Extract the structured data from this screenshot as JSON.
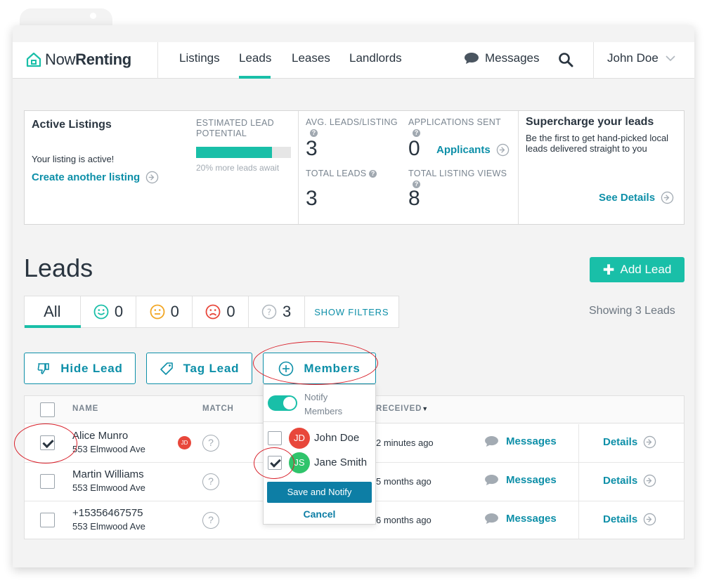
{
  "brand": {
    "name_a": "Now",
    "name_b": "Renting"
  },
  "nav": {
    "items": [
      "Listings",
      "Leads",
      "Leases",
      "Landlords"
    ],
    "messages": "Messages",
    "user": "John Doe"
  },
  "stats": {
    "active_title": "Active Listings",
    "active_text": "Your listing is active!",
    "create_link": "Create another listing",
    "estimated_label": "ESTIMATED LEAD POTENTIAL",
    "estimated_fraction": 0.8,
    "estimated_note": "20% more leads await",
    "avg_label": "AVG. LEADS/LISTING",
    "avg_value": "3",
    "total_label": "TOTAL LEADS",
    "total_value": "3",
    "apps_label": "APPLICATIONS SENT",
    "apps_value": "0",
    "applicants_link": "Applicants",
    "views_label": "TOTAL LISTING VIEWS",
    "views_value": "8",
    "promo_title": "Supercharge your leads",
    "promo_text": "Be the first to get hand-picked local leads delivered straight to you",
    "see_details": "See Details"
  },
  "leads": {
    "title": "Leads",
    "add_button": "Add Lead",
    "filters": {
      "all": "All",
      "happy": "0",
      "neutral": "0",
      "sad": "0",
      "unknown": "3",
      "show_filters": "SHOW FILTERS"
    },
    "showing": "Showing 3 Leads",
    "actions": {
      "hide": "Hide Lead",
      "tag": "Tag Lead",
      "members": "Members"
    },
    "columns": {
      "name": "NAME",
      "match": "MATCH",
      "received": "RECEIVED"
    },
    "rows": [
      {
        "name": "Alice Munro",
        "address": "553 Elmwood Ave",
        "initials": "JD",
        "received": "2 minutes ago",
        "messages": "Messages",
        "details": "Details",
        "checked": true
      },
      {
        "name": "Martin Williams",
        "address": "553 Elmwood Ave",
        "received": "5 months ago",
        "messages": "Messages",
        "details": "Details",
        "checked": false
      },
      {
        "name": "+15356467575",
        "address": "553 Elmwood Ave",
        "received": "6 months ago",
        "messages": "Messages",
        "details": "Details",
        "checked": false
      }
    ]
  },
  "members_dropdown": {
    "notify_label": "Notify Members",
    "members": [
      {
        "initials": "JD",
        "name": "John Doe",
        "color": "#e8473b",
        "checked": false
      },
      {
        "initials": "JS",
        "name": "Jane Smith",
        "color": "#2fc46b",
        "checked": true
      }
    ],
    "save": "Save and Notify",
    "cancel": "Cancel"
  },
  "colors": {
    "accent": "#19bfa8",
    "link": "#0d8fa8",
    "annotation": "#d8202a"
  }
}
